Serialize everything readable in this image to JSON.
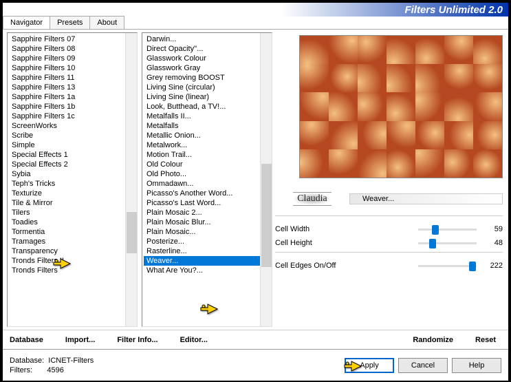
{
  "header": {
    "title": "Filters Unlimited 2.0"
  },
  "tabs": [
    {
      "label": "Navigator",
      "active": true
    },
    {
      "label": "Presets",
      "active": false
    },
    {
      "label": "About",
      "active": false
    }
  ],
  "category_list": {
    "items": [
      "Sapphire Filters 07",
      "Sapphire Filters 08",
      "Sapphire Filters 09",
      "Sapphire Filters 10",
      "Sapphire Filters 11",
      "Sapphire Filters 13",
      "Sapphire Filters 1a",
      "Sapphire Filters 1b",
      "Sapphire Filters 1c",
      "ScreenWorks",
      "Scribe",
      "Simple",
      "Special Effects 1",
      "Special Effects 2",
      "Sybia",
      "Teph's Tricks",
      "Texturize",
      "Tile & Mirror",
      "Tilers",
      "Toadies",
      "Tormentia",
      "Tramages",
      "Transparency",
      "Tronds Filters II",
      "Tronds Filters"
    ],
    "selected_index": -1
  },
  "filter_list": {
    "items": [
      "Darwin...",
      "Direct Opacity''...",
      "Glasswork Colour",
      "Glasswork Gray",
      "Grey removing BOOST",
      "Living Sine (circular)",
      "Living Sine (linear)",
      "Look, Butthead, a TV!...",
      "Metalfalls II...",
      "Metalfalls",
      "Metallic Onion...",
      "Metalwork...",
      "Motion Trail...",
      "Old Colour",
      "Old Photo...",
      "Ommadawn...",
      "Picasso's Another Word...",
      "Picasso's Last Word...",
      "Plain Mosaic 2...",
      "Plain Mosaic Blur...",
      "Plain Mosaic...",
      "Posterize...",
      "Rasterline...",
      "Weaver...",
      "What Are You?..."
    ],
    "selected_index": 23
  },
  "selected_filter_name": "Weaver...",
  "logo_text": "Claudia",
  "params": [
    {
      "label": "Cell Width",
      "value": 59,
      "max": 255
    },
    {
      "label": "Cell Height",
      "value": 48,
      "max": 255
    },
    {
      "label": "Cell Edges On/Off",
      "value": 222,
      "max": 255
    }
  ],
  "bottom_links": {
    "database": "Database",
    "import": "Import...",
    "filter_info": "Filter Info...",
    "editor": "Editor...",
    "randomize": "Randomize",
    "reset": "Reset"
  },
  "status": {
    "db_label": "Database:",
    "db_value": "ICNET-Filters",
    "filters_label": "Filters:",
    "filters_value": "4596"
  },
  "buttons": {
    "apply": "Apply",
    "cancel": "Cancel",
    "help": "Help"
  }
}
